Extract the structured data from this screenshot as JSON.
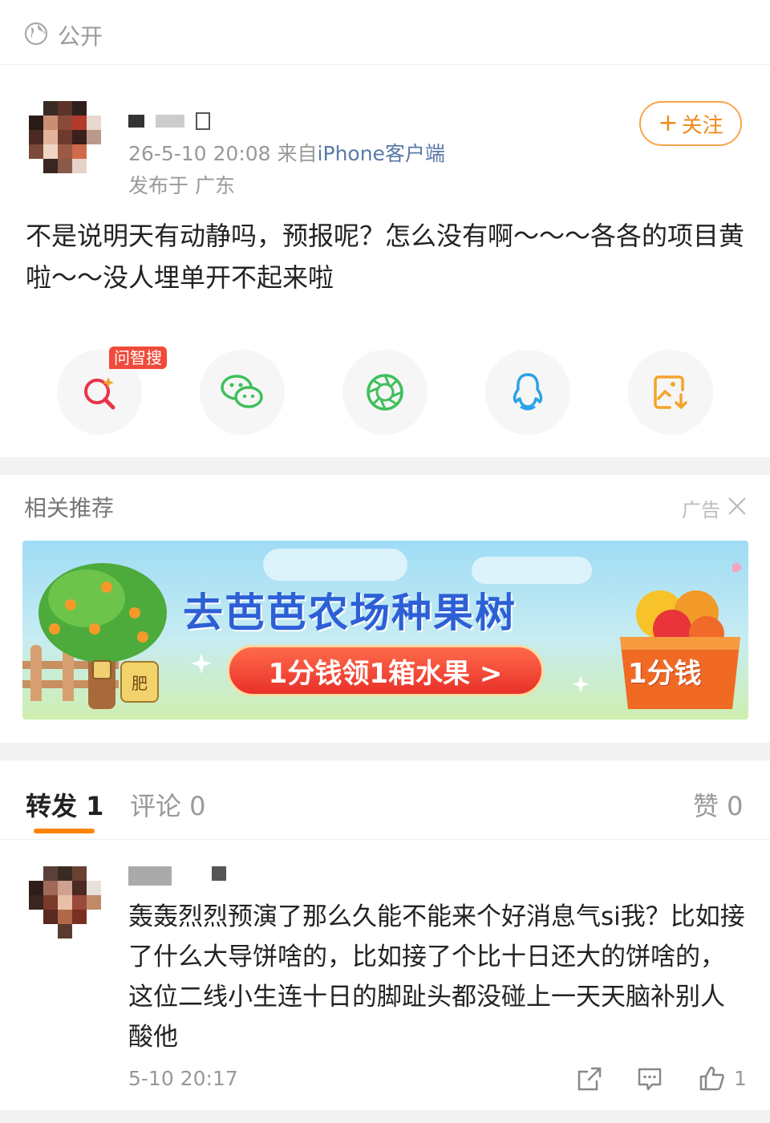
{
  "visibility": {
    "label": "公开"
  },
  "post": {
    "datetime": "26-5-10 20:08",
    "from_prefix": "来自",
    "source": "iPhone客户端",
    "location": "发布于 广东",
    "follow_label": "关注",
    "text": "不是说明天有动静吗，预报呢？怎么没有啊～～～各各的项目黄啦～～没人埋单开不起来啦"
  },
  "share": {
    "badge": "问智搜",
    "buttons": [
      "search-ai",
      "wechat",
      "moments",
      "qq",
      "save-image"
    ]
  },
  "recommend": {
    "title": "相关推荐",
    "ad_label": "广告",
    "banner_title": "去芭芭农场种果树",
    "banner_button": "1分钱领1箱水果 >",
    "banner_price": "1分钱",
    "fertilizer": "肥"
  },
  "tabs": {
    "repost": "转发 1",
    "comment": "评论 0",
    "like": "赞 0"
  },
  "comment": {
    "text": "轰轰烈烈预演了那么久能不能来个好消息气si我？比如接了什么大导饼啥的，比如接了个比十日还大的饼啥的，这位二线小生连十日的脚趾头都没碰上一天天脑补别人酸他",
    "time": "5-10 20:17",
    "like_count": "1"
  },
  "colors": {
    "accent": "#ff8200",
    "link": "#5a79a8",
    "badge": "#f04a3a"
  }
}
